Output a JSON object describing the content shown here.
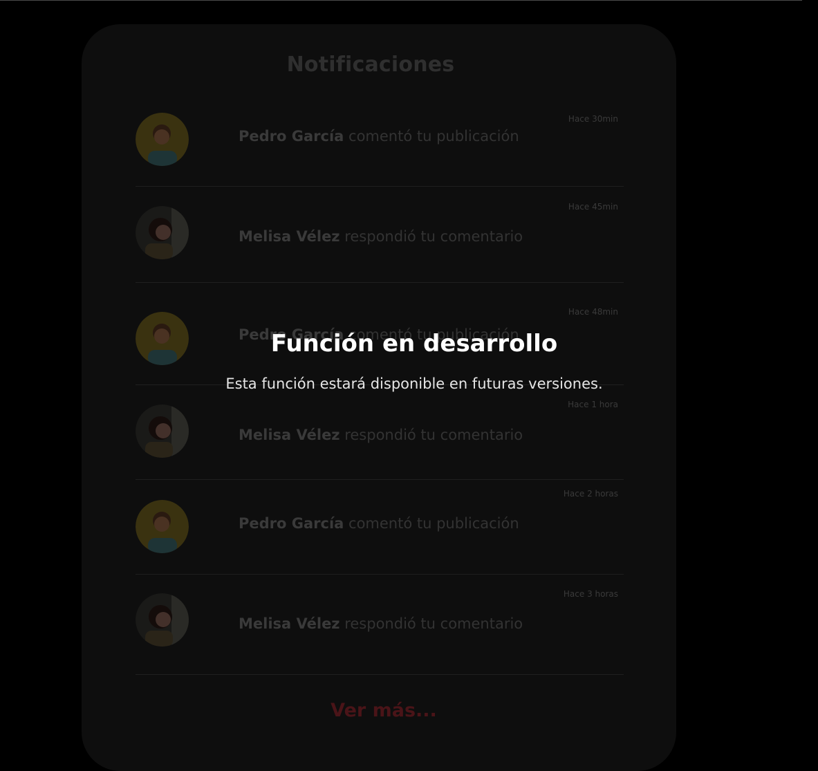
{
  "header": {
    "title": "Notificaciones"
  },
  "notifications": [
    {
      "user": "Pedro García",
      "action": "comentó tu publicación",
      "time": "Hace 30min",
      "avatar": "pedro-avatar"
    },
    {
      "user": "Melisa Vélez",
      "action": "respondió  tu comentario",
      "time": "Hace 45min",
      "avatar": "melisa-avatar"
    },
    {
      "user": "Pedro García",
      "action": "comentó tu publicación",
      "time": "Hace 48min",
      "avatar": "pedro-avatar"
    },
    {
      "user": "Melisa Vélez",
      "action": "respondió  tu comentario",
      "time": "Hace 1 hora",
      "avatar": "melisa-avatar"
    },
    {
      "user": "Pedro García",
      "action": "comentó tu publicación",
      "time": "Hace 2 horas",
      "avatar": "pedro-avatar"
    },
    {
      "user": "Melisa Vélez",
      "action": "respondió  tu comentario",
      "time": "Hace 3 horas",
      "avatar": "melisa-avatar"
    }
  ],
  "footer": {
    "more_label": "Ver más..."
  },
  "overlay": {
    "title": "Función en desarrollo",
    "subtitle": "Esta función estará disponible en futuras versiones."
  },
  "colors": {
    "background": "#000000",
    "card": "#0e0e0e",
    "accent": "#4a1418"
  }
}
